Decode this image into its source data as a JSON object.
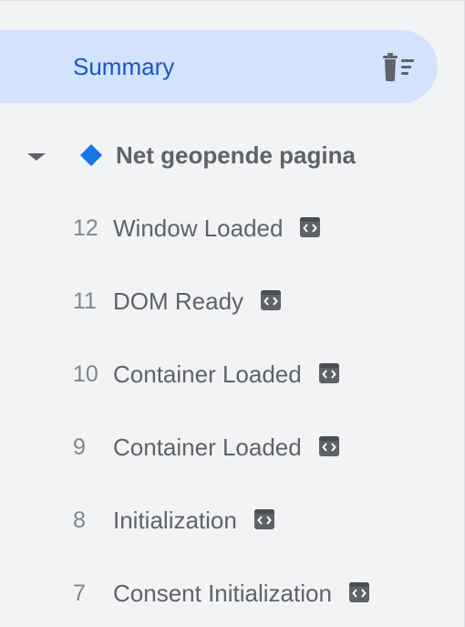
{
  "summary": {
    "label": "Summary",
    "icon": "clear-list-icon"
  },
  "page": {
    "title": "Net geopende pagina",
    "icon": "diamond-icon",
    "expanded": true
  },
  "events": [
    {
      "number": "12",
      "label": "Window Loaded",
      "icon": "code-tag-icon"
    },
    {
      "number": "11",
      "label": "DOM Ready",
      "icon": "code-tag-icon"
    },
    {
      "number": "10",
      "label": "Container Loaded",
      "icon": "code-tag-icon"
    },
    {
      "number": "9",
      "label": "Container Loaded",
      "icon": "code-tag-icon"
    },
    {
      "number": "8",
      "label": "Initialization",
      "icon": "code-tag-icon"
    },
    {
      "number": "7",
      "label": "Consent Initialization",
      "icon": "code-tag-icon"
    }
  ],
  "colors": {
    "background": "#f1f3f4",
    "summary_bg": "#d3e3fd",
    "summary_text": "#1a56c4",
    "text": "#5f6368",
    "number": "#80868b",
    "diamond": "#1a73e8",
    "icon": "#5f6368"
  }
}
